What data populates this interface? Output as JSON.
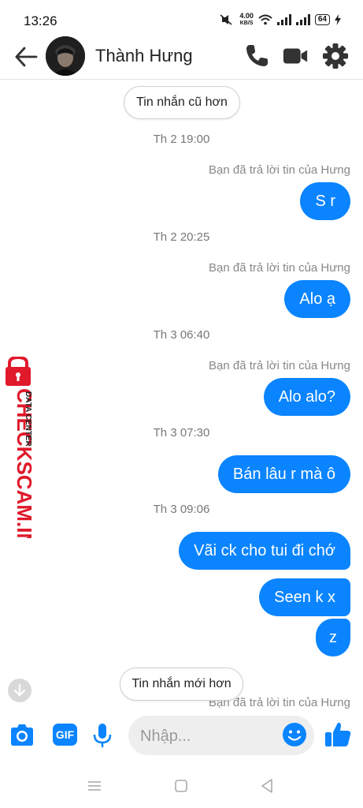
{
  "status_bar": {
    "time": "13:26",
    "net_speed_value": "4.00",
    "net_speed_unit": "KB/S",
    "battery": "64"
  },
  "header": {
    "contact_name": "Thành Hưng"
  },
  "colors": {
    "accent": "#0a84ff",
    "watermark_red": "#e0192b"
  },
  "conversation": {
    "older_button": "Tin nhắn cũ hơn",
    "newer_button": "Tin nhắn mới hơn",
    "items": [
      {
        "timestamp": "Th 2 19:00",
        "reply_note": "Bạn đã trả lời tin của Hưng",
        "messages": [
          "S r"
        ]
      },
      {
        "timestamp": "Th 2 20:25",
        "reply_note": "Bạn đã trả lời tin của Hưng",
        "messages": [
          "Alo ạ"
        ]
      },
      {
        "timestamp": "Th 3 06:40",
        "reply_note": "Bạn đã trả lời tin của Hưng",
        "messages": [
          "Alo alo?"
        ]
      },
      {
        "timestamp": "Th 3 07:30",
        "messages": [
          "Bán lâu r mà ô"
        ]
      },
      {
        "timestamp": "Th 3 09:06",
        "messages": [
          "Vãi ck cho tui đi chớ",
          "Seen k x",
          "z"
        ]
      }
    ],
    "bottom_reply_note": "Bạn đã trả lời tin của Hưng"
  },
  "watermark": {
    "top_text": "DATA CENTER",
    "main_text": "CHECKSCAM.INFO"
  },
  "composer": {
    "placeholder": "Nhập...",
    "gif_label": "GIF"
  },
  "icons": {
    "header": [
      "back-arrow-icon",
      "phone-icon",
      "video-camera-icon",
      "gear-icon"
    ],
    "composer": [
      "camera-icon",
      "gif-icon",
      "microphone-icon",
      "emoji-icon",
      "thumbs-up-icon"
    ],
    "navbar": [
      "menu-icon",
      "home-icon",
      "back-icon"
    ]
  }
}
